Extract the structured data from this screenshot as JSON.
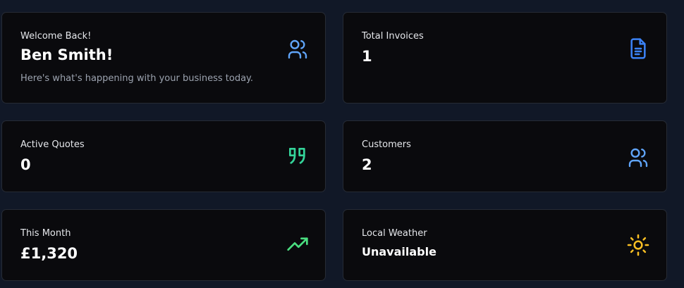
{
  "welcome": {
    "greeting": "Welcome Back!",
    "name": "Ben Smith!",
    "subtitle": "Here's what's happening with your business today.",
    "icon": "users-icon",
    "icon_color": "#60a5fa"
  },
  "stats": {
    "invoices": {
      "label": "Total Invoices",
      "value": "1",
      "icon": "document-icon",
      "icon_color": "#3b82f6"
    },
    "quotes": {
      "label": "Active Quotes",
      "value": "0",
      "icon": "quote-icon",
      "icon_color": "#34d399"
    },
    "customers": {
      "label": "Customers",
      "value": "2",
      "icon": "users-icon",
      "icon_color": "#60a5fa"
    },
    "month": {
      "label": "This Month",
      "value": "£1,320",
      "icon": "trending-up-icon",
      "icon_color": "#4ade80"
    },
    "weather": {
      "label": "Local Weather",
      "value": "Unavailable",
      "icon": "sun-icon",
      "icon_color": "#fbbf24"
    }
  },
  "colors": {
    "background": "#111827",
    "card": "#0a0a0d",
    "card_border": "#262b35"
  }
}
